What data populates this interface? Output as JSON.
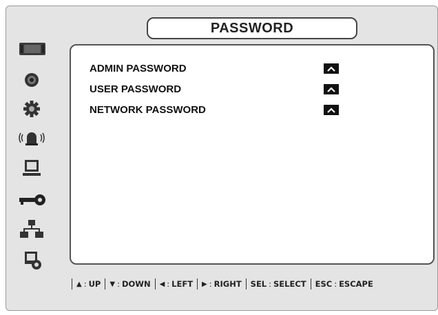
{
  "header": {
    "title": "PASSWORD"
  },
  "sidebar": {
    "items": [
      {
        "icon": "monitor-display-icon"
      },
      {
        "icon": "disc-record-icon"
      },
      {
        "icon": "gear-icon"
      },
      {
        "icon": "alarm-siren-icon"
      },
      {
        "icon": "computer-terminal-icon"
      },
      {
        "icon": "key-icon"
      },
      {
        "icon": "network-icon"
      },
      {
        "icon": "system-info-icon"
      }
    ]
  },
  "main": {
    "rows": [
      {
        "label": "ADMIN PASSWORD",
        "control_icon": "caret-up-icon"
      },
      {
        "label": "USER PASSWORD",
        "control_icon": "caret-up-icon"
      },
      {
        "label": "NETWORK PASSWORD",
        "control_icon": "caret-up-icon"
      }
    ]
  },
  "footer": {
    "hints": [
      {
        "key_icon": "triangle-up-icon",
        "text": "UP"
      },
      {
        "key_icon": "triangle-down-icon",
        "text": "DOWN"
      },
      {
        "key_icon": "triangle-left-icon",
        "text": "LEFT"
      },
      {
        "key_icon": "triangle-right-icon",
        "text": "RIGHT"
      },
      {
        "key": "SEL",
        "text": "SELECT"
      },
      {
        "key": "ESC",
        "text": "ESCAPE"
      }
    ]
  },
  "colors": {
    "background": "#e4e4e4",
    "panel": "#ffffff",
    "accent": "#111111"
  }
}
